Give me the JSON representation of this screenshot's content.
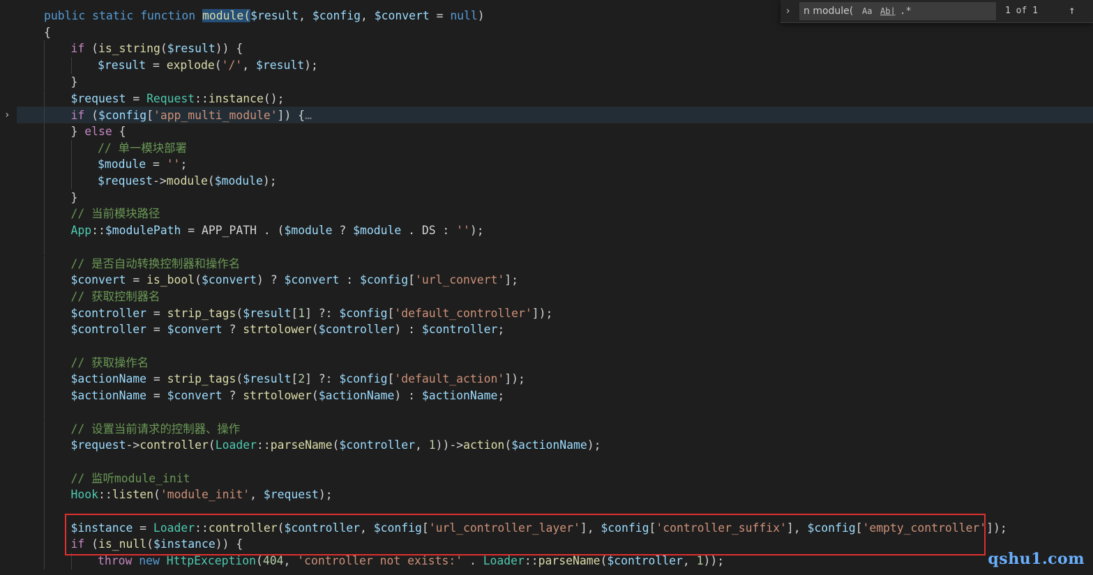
{
  "editor": {
    "lines": [
      {
        "indent": 1,
        "tokens": [
          [
            "kw",
            "public"
          ],
          [
            "op",
            " "
          ],
          [
            "kw",
            "static"
          ],
          [
            "op",
            " "
          ],
          [
            "kw",
            "function"
          ],
          [
            "op",
            " "
          ],
          [
            "hlfn",
            "module("
          ],
          [
            "var",
            "$result"
          ],
          [
            "op",
            ", "
          ],
          [
            "var",
            "$config"
          ],
          [
            "op",
            ", "
          ],
          [
            "var",
            "$convert"
          ],
          [
            "op",
            " = "
          ],
          [
            "kw",
            "null"
          ],
          [
            "op",
            ")"
          ]
        ]
      },
      {
        "indent": 1,
        "tokens": [
          [
            "op",
            "{"
          ]
        ]
      },
      {
        "indent": 2,
        "tokens": [
          [
            "ctrl",
            "if"
          ],
          [
            "op",
            " ("
          ],
          [
            "fn",
            "is_string"
          ],
          [
            "op",
            "("
          ],
          [
            "var",
            "$result"
          ],
          [
            "op",
            ")) {"
          ]
        ]
      },
      {
        "indent": 3,
        "tokens": [
          [
            "var",
            "$result"
          ],
          [
            "op",
            " = "
          ],
          [
            "fn",
            "explode"
          ],
          [
            "op",
            "("
          ],
          [
            "str",
            "'/'"
          ],
          [
            "op",
            ", "
          ],
          [
            "var",
            "$result"
          ],
          [
            "op",
            ");"
          ]
        ]
      },
      {
        "indent": 2,
        "tokens": [
          [
            "op",
            "}"
          ]
        ]
      },
      {
        "indent": 2,
        "tokens": [
          [
            "var",
            "$request"
          ],
          [
            "op",
            " = "
          ],
          [
            "cls",
            "Request"
          ],
          [
            "op",
            "::"
          ],
          [
            "fn",
            "instance"
          ],
          [
            "op",
            "();"
          ]
        ]
      },
      {
        "indent": 2,
        "current": true,
        "tokens": [
          [
            "ctrl",
            "if"
          ],
          [
            "op",
            " ("
          ],
          [
            "var",
            "$config"
          ],
          [
            "op",
            "["
          ],
          [
            "str",
            "'app_multi_module'"
          ],
          [
            "op",
            "]) {"
          ],
          [
            "ell",
            "…"
          ]
        ]
      },
      {
        "indent": 2,
        "tokens": [
          [
            "op",
            "} "
          ],
          [
            "ctrl",
            "else"
          ],
          [
            "op",
            " {"
          ]
        ]
      },
      {
        "indent": 3,
        "tokens": [
          [
            "cm",
            "// 单一模块部署"
          ]
        ]
      },
      {
        "indent": 3,
        "tokens": [
          [
            "var",
            "$module"
          ],
          [
            "op",
            " = "
          ],
          [
            "str",
            "''"
          ],
          [
            "op",
            ";"
          ]
        ]
      },
      {
        "indent": 3,
        "tokens": [
          [
            "var",
            "$request"
          ],
          [
            "op",
            "->"
          ],
          [
            "fn",
            "module"
          ],
          [
            "op",
            "("
          ],
          [
            "var",
            "$module"
          ],
          [
            "op",
            ");"
          ]
        ]
      },
      {
        "indent": 2,
        "tokens": [
          [
            "op",
            "}"
          ]
        ]
      },
      {
        "indent": 2,
        "tokens": [
          [
            "cm",
            "// 当前模块路径"
          ]
        ]
      },
      {
        "indent": 2,
        "tokens": [
          [
            "cls",
            "App"
          ],
          [
            "op",
            "::"
          ],
          [
            "var",
            "$modulePath"
          ],
          [
            "op",
            " = APP_PATH . ("
          ],
          [
            "var",
            "$module"
          ],
          [
            "op",
            " ? "
          ],
          [
            "var",
            "$module"
          ],
          [
            "op",
            " . DS : "
          ],
          [
            "str",
            "''"
          ],
          [
            "op",
            ");"
          ]
        ]
      },
      {
        "indent": 2,
        "tokens": []
      },
      {
        "indent": 2,
        "tokens": [
          [
            "cm",
            "// 是否自动转换控制器和操作名"
          ]
        ]
      },
      {
        "indent": 2,
        "tokens": [
          [
            "var",
            "$convert"
          ],
          [
            "op",
            " = "
          ],
          [
            "fn",
            "is_bool"
          ],
          [
            "op",
            "("
          ],
          [
            "var",
            "$convert"
          ],
          [
            "op",
            ") ? "
          ],
          [
            "var",
            "$convert"
          ],
          [
            "op",
            " : "
          ],
          [
            "var",
            "$config"
          ],
          [
            "op",
            "["
          ],
          [
            "str",
            "'url_convert'"
          ],
          [
            "op",
            "];"
          ]
        ]
      },
      {
        "indent": 2,
        "tokens": [
          [
            "cm",
            "// 获取控制器名"
          ]
        ]
      },
      {
        "indent": 2,
        "tokens": [
          [
            "var",
            "$controller"
          ],
          [
            "op",
            " = "
          ],
          [
            "fn",
            "strip_tags"
          ],
          [
            "op",
            "("
          ],
          [
            "var",
            "$result"
          ],
          [
            "op",
            "["
          ],
          [
            "num",
            "1"
          ],
          [
            "op",
            "] ?: "
          ],
          [
            "var",
            "$config"
          ],
          [
            "op",
            "["
          ],
          [
            "str",
            "'default_controller'"
          ],
          [
            "op",
            "]);"
          ]
        ]
      },
      {
        "indent": 2,
        "tokens": [
          [
            "var",
            "$controller"
          ],
          [
            "op",
            " = "
          ],
          [
            "var",
            "$convert"
          ],
          [
            "op",
            " ? "
          ],
          [
            "fn",
            "strtolower"
          ],
          [
            "op",
            "("
          ],
          [
            "var",
            "$controller"
          ],
          [
            "op",
            ") : "
          ],
          [
            "var",
            "$controller"
          ],
          [
            "op",
            ";"
          ]
        ]
      },
      {
        "indent": 2,
        "tokens": []
      },
      {
        "indent": 2,
        "tokens": [
          [
            "cm",
            "// 获取操作名"
          ]
        ]
      },
      {
        "indent": 2,
        "tokens": [
          [
            "var",
            "$actionName"
          ],
          [
            "op",
            " = "
          ],
          [
            "fn",
            "strip_tags"
          ],
          [
            "op",
            "("
          ],
          [
            "var",
            "$result"
          ],
          [
            "op",
            "["
          ],
          [
            "num",
            "2"
          ],
          [
            "op",
            "] ?: "
          ],
          [
            "var",
            "$config"
          ],
          [
            "op",
            "["
          ],
          [
            "str",
            "'default_action'"
          ],
          [
            "op",
            "]);"
          ]
        ]
      },
      {
        "indent": 2,
        "tokens": [
          [
            "var",
            "$actionName"
          ],
          [
            "op",
            " = "
          ],
          [
            "var",
            "$convert"
          ],
          [
            "op",
            " ? "
          ],
          [
            "fn",
            "strtolower"
          ],
          [
            "op",
            "("
          ],
          [
            "var",
            "$actionName"
          ],
          [
            "op",
            ") : "
          ],
          [
            "var",
            "$actionName"
          ],
          [
            "op",
            ";"
          ]
        ]
      },
      {
        "indent": 2,
        "tokens": []
      },
      {
        "indent": 2,
        "tokens": [
          [
            "cm",
            "// 设置当前请求的控制器、操作"
          ]
        ]
      },
      {
        "indent": 2,
        "tokens": [
          [
            "var",
            "$request"
          ],
          [
            "op",
            "->"
          ],
          [
            "fn",
            "controller"
          ],
          [
            "op",
            "("
          ],
          [
            "cls",
            "Loader"
          ],
          [
            "op",
            "::"
          ],
          [
            "fn",
            "parseName"
          ],
          [
            "op",
            "("
          ],
          [
            "var",
            "$controller"
          ],
          [
            "op",
            ", "
          ],
          [
            "num",
            "1"
          ],
          [
            "op",
            "))->"
          ],
          [
            "fn",
            "action"
          ],
          [
            "op",
            "("
          ],
          [
            "var",
            "$actionName"
          ],
          [
            "op",
            ");"
          ]
        ]
      },
      {
        "indent": 2,
        "tokens": []
      },
      {
        "indent": 2,
        "tokens": [
          [
            "cm",
            "// 监听module_init"
          ]
        ]
      },
      {
        "indent": 2,
        "tokens": [
          [
            "cls",
            "Hook"
          ],
          [
            "op",
            "::"
          ],
          [
            "fn",
            "listen"
          ],
          [
            "op",
            "("
          ],
          [
            "str",
            "'module_init'"
          ],
          [
            "op",
            ", "
          ],
          [
            "var",
            "$request"
          ],
          [
            "op",
            ");"
          ]
        ]
      },
      {
        "indent": 2,
        "tokens": []
      },
      {
        "indent": 2,
        "tokens": [
          [
            "var",
            "$instance"
          ],
          [
            "op",
            " = "
          ],
          [
            "cls",
            "Loader"
          ],
          [
            "op",
            "::"
          ],
          [
            "fn",
            "controller"
          ],
          [
            "op",
            "("
          ],
          [
            "var",
            "$controller"
          ],
          [
            "op",
            ", "
          ],
          [
            "var",
            "$config"
          ],
          [
            "op",
            "["
          ],
          [
            "str",
            "'url_controller_layer'"
          ],
          [
            "op",
            "], "
          ],
          [
            "var",
            "$config"
          ],
          [
            "op",
            "["
          ],
          [
            "str",
            "'controller_suffix'"
          ],
          [
            "op",
            "], "
          ],
          [
            "var",
            "$config"
          ],
          [
            "op",
            "["
          ],
          [
            "str",
            "'empty_controller'"
          ],
          [
            "op",
            "]);"
          ]
        ]
      },
      {
        "indent": 2,
        "tokens": [
          [
            "ctrl",
            "if"
          ],
          [
            "op",
            " ("
          ],
          [
            "fn",
            "is_null"
          ],
          [
            "op",
            "("
          ],
          [
            "var",
            "$instance"
          ],
          [
            "op",
            ")) {"
          ]
        ]
      },
      {
        "indent": 3,
        "tokens": [
          [
            "ctrl",
            "throw"
          ],
          [
            "op",
            " "
          ],
          [
            "kw",
            "new"
          ],
          [
            "op",
            " "
          ],
          [
            "cls",
            "HttpException"
          ],
          [
            "op",
            "("
          ],
          [
            "num",
            "404"
          ],
          [
            "op",
            ", "
          ],
          [
            "str",
            "'controller not exists:'"
          ],
          [
            "op",
            " . "
          ],
          [
            "cls",
            "Loader"
          ],
          [
            "op",
            "::"
          ],
          [
            "fn",
            "parseName"
          ],
          [
            "op",
            "("
          ],
          [
            "var",
            "$controller"
          ],
          [
            "op",
            ", "
          ],
          [
            "num",
            "1"
          ],
          [
            "op",
            "));"
          ]
        ]
      }
    ]
  },
  "find_widget": {
    "toggle_icon": "›",
    "query": "n module(",
    "match_case_label": "Aa",
    "whole_word_label": "Ab|",
    "regex_label": ".*",
    "match_count": "1 of 1",
    "prev_icon": "↑"
  },
  "gutter": {
    "fold_icon": "›"
  },
  "watermark": "qshu1.com"
}
